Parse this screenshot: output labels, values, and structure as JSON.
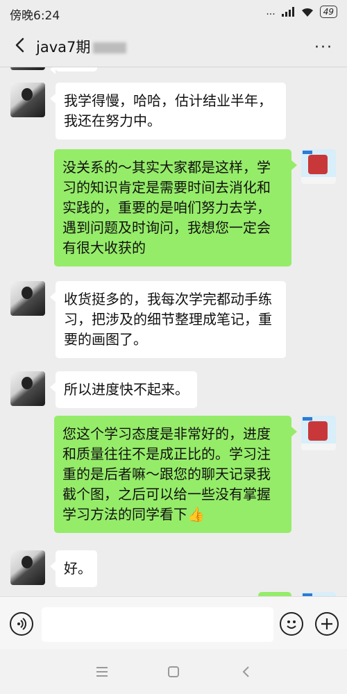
{
  "status_bar": {
    "time": "傍晚6:24",
    "signal_text": "...",
    "battery": "49"
  },
  "header": {
    "title": "java7期",
    "more_label": "···"
  },
  "messages": [
    {
      "sender": "other",
      "text": "我学得慢，哈哈，估计结业半年，我还在努力中。"
    },
    {
      "sender": "me",
      "text": "没关系的～其实大家都是这样，学习的知识肯定是需要时间去消化和实践的，重要的是咱们努力去学，遇到问题及时询问，我想您一定会有很大收获的"
    },
    {
      "sender": "other",
      "text": "收货挺多的，我每次学完都动手练习，把涉及的细节整理成笔记，重要的画图了。"
    },
    {
      "sender": "other",
      "text": "所以进度快不起来。"
    },
    {
      "sender": "me",
      "text": "您这个学习态度是非常好的，进度和质量往往不是成正比的。学习注重的是后者嘛～跟您的聊天记录我截个图，之后可以给一些没有掌握学习方法的同学看下",
      "emoji": "👍"
    },
    {
      "sender": "other",
      "text": "好。"
    }
  ],
  "input": {
    "placeholder": ""
  },
  "nav": {
    "menu": "menu-icon",
    "home": "home-icon",
    "back": "back-icon"
  },
  "colors": {
    "my_bubble": "#95ec69",
    "other_bubble": "#ffffff",
    "background": "#ededed"
  }
}
